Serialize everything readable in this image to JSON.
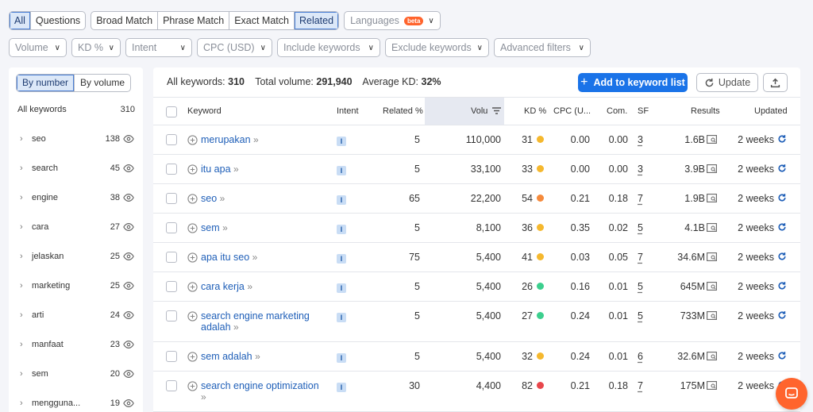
{
  "filters": {
    "scope_tabs": [
      "All",
      "Questions"
    ],
    "match_tabs": [
      "Broad Match",
      "Phrase Match",
      "Exact Match",
      "Related"
    ],
    "languages": "Languages",
    "beta": "beta",
    "row2": [
      "Volume",
      "KD %",
      "Intent",
      "CPC (USD)",
      "Include keywords",
      "Exclude keywords",
      "Advanced filters"
    ]
  },
  "sidebar": {
    "toggle": [
      "By number",
      "By volume"
    ],
    "all_label": "All keywords",
    "all_count": "310",
    "items": [
      {
        "label": "seo",
        "count": "138"
      },
      {
        "label": "search",
        "count": "45"
      },
      {
        "label": "engine",
        "count": "38"
      },
      {
        "label": "cara",
        "count": "27"
      },
      {
        "label": "jelaskan",
        "count": "25"
      },
      {
        "label": "marketing",
        "count": "25"
      },
      {
        "label": "arti",
        "count": "24"
      },
      {
        "label": "manfaat",
        "count": "23"
      },
      {
        "label": "sem",
        "count": "20"
      },
      {
        "label": "menggunа...",
        "count": "19"
      }
    ]
  },
  "summary": {
    "all_label": "All keywords:",
    "all_value": "310",
    "vol_label": "Total volume:",
    "vol_value": "291,940",
    "kd_label": "Average KD:",
    "kd_value": "32%"
  },
  "actions": {
    "add": "Add to keyword list",
    "update": "Update"
  },
  "table": {
    "headers": {
      "keyword": "Keyword",
      "intent": "Intent",
      "related": "Related %",
      "volume": "Volu",
      "kd": "KD %",
      "cpc": "CPC (U...",
      "com": "Com.",
      "sf": "SF",
      "results": "Results",
      "updated": "Updated"
    },
    "rows": [
      {
        "kw": "merupakan",
        "intent": "I",
        "related": "5",
        "volume": "110,000",
        "kd": "31",
        "kd_color": "#f5b82e",
        "cpc": "0.00",
        "com": "0.00",
        "sf": "3",
        "results": "1.6B",
        "updated": "2 weeks"
      },
      {
        "kw": "itu apa",
        "intent": "I",
        "related": "5",
        "volume": "33,100",
        "kd": "33",
        "kd_color": "#f5b82e",
        "cpc": "0.00",
        "com": "0.00",
        "sf": "3",
        "results": "3.9B",
        "updated": "2 weeks"
      },
      {
        "kw": "seo",
        "intent": "I",
        "related": "65",
        "volume": "22,200",
        "kd": "54",
        "kd_color": "#f58a3c",
        "cpc": "0.21",
        "com": "0.18",
        "sf": "7",
        "results": "1.9B",
        "updated": "2 weeks"
      },
      {
        "kw": "sem",
        "intent": "I",
        "related": "5",
        "volume": "8,100",
        "kd": "36",
        "kd_color": "#f5b82e",
        "cpc": "0.35",
        "com": "0.02",
        "sf": "5",
        "results": "4.1B",
        "updated": "2 weeks"
      },
      {
        "kw": "apa itu seo",
        "intent": "I",
        "related": "75",
        "volume": "5,400",
        "kd": "41",
        "kd_color": "#f5b82e",
        "cpc": "0.03",
        "com": "0.05",
        "sf": "7",
        "results": "34.6M",
        "updated": "2 weeks"
      },
      {
        "kw": "cara kerja",
        "intent": "I",
        "related": "5",
        "volume": "5,400",
        "kd": "26",
        "kd_color": "#3ccf8e",
        "cpc": "0.16",
        "com": "0.01",
        "sf": "5",
        "results": "645M",
        "updated": "2 weeks"
      },
      {
        "kw": "search engine marketing",
        "kw2": "adalah",
        "intent": "I",
        "related": "5",
        "volume": "5,400",
        "kd": "27",
        "kd_color": "#3ccf8e",
        "cpc": "0.24",
        "com": "0.01",
        "sf": "5",
        "results": "733M",
        "updated": "2 weeks"
      },
      {
        "kw": "sem adalah",
        "intent": "I",
        "related": "5",
        "volume": "5,400",
        "kd": "32",
        "kd_color": "#f5b82e",
        "cpc": "0.24",
        "com": "0.01",
        "sf": "6",
        "results": "32.6M",
        "updated": "2 weeks"
      },
      {
        "kw": "search engine optimization",
        "kw2": "",
        "intent": "I",
        "related": "30",
        "volume": "4,400",
        "kd": "82",
        "kd_color": "#e8474c",
        "cpc": "0.21",
        "com": "0.18",
        "sf": "7",
        "results": "175M",
        "updated": "2 weeks"
      }
    ]
  },
  "colors": {
    "accent": "#1a73e8",
    "link": "#1f5fb8",
    "chat": "#ff642d"
  }
}
